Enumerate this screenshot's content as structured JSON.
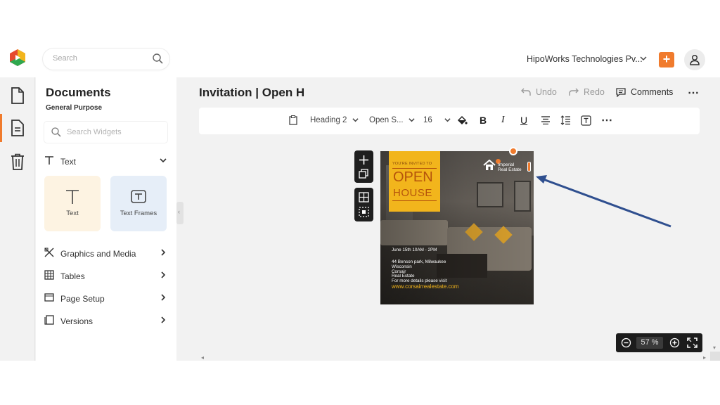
{
  "header": {
    "search_placeholder": "Search",
    "org_name": "HipoWorks Technologies Pv...",
    "add_label": "+"
  },
  "panel": {
    "title": "Documents",
    "subtitle": "General Purpose",
    "search_placeholder": "Search Widgets",
    "text_section": "Text",
    "cards": [
      {
        "label": "Text"
      },
      {
        "label": "Text Frames"
      }
    ],
    "sections": [
      {
        "label": "Graphics and Media"
      },
      {
        "label": "Tables"
      },
      {
        "label": "Page Setup"
      },
      {
        "label": "Versions"
      }
    ]
  },
  "document": {
    "title": "Invitation | Open H",
    "undo": "Undo",
    "redo": "Redo",
    "comments": "Comments"
  },
  "toolbar": {
    "style": "Heading 2",
    "font": "Open S...",
    "size": "16"
  },
  "flyer": {
    "invited": "YOU'RE INVITED TO",
    "open": "OPEN",
    "house": "HOUSE",
    "brand_line1": "Imperial",
    "brand_line2": "Real Estate",
    "date": "June 15th 10AM - 2PM",
    "address1": "44 Benson park, Milwaukee",
    "address2": "Wisconsin",
    "company1": "Corsair",
    "company2": "Real Estate",
    "details": "For more details please visit",
    "url": "www.corsairrealestate.com"
  },
  "zoom": {
    "value": "57 %"
  },
  "colors": {
    "accent": "#f07b2d",
    "flyer_yellow": "#f2b51c",
    "arrow": "#2f4f8f"
  }
}
